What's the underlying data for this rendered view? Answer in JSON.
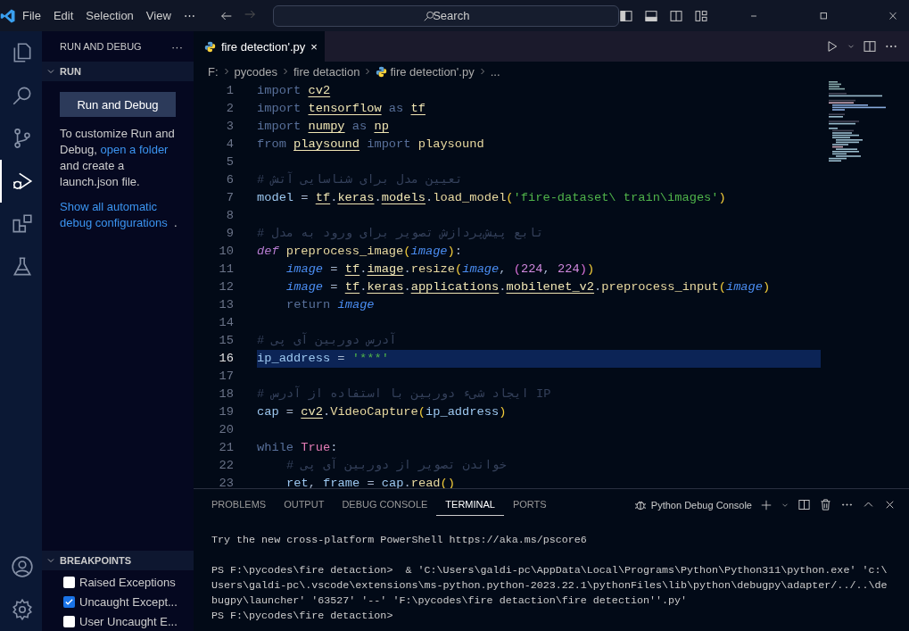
{
  "menu": [
    "File",
    "Edit",
    "Selection",
    "View",
    "⋯"
  ],
  "search": {
    "placeholder": "Search"
  },
  "activity_bar": [
    {
      "kind": "explorer",
      "selected": false
    },
    {
      "kind": "search",
      "selected": false
    },
    {
      "kind": "source-control",
      "selected": false
    },
    {
      "kind": "run-debug",
      "selected": true
    },
    {
      "kind": "extensions",
      "selected": false
    },
    {
      "kind": "testing",
      "selected": false
    }
  ],
  "sidebar": {
    "title": "RUN AND DEBUG",
    "more": "···",
    "run_section": {
      "title": "RUN",
      "expanded": true,
      "button": "Run and Debug",
      "text_before_link": "To customize Run and Debug, ",
      "link": "open a folder",
      "text_after_link": " and create a launch.json file.",
      "link2": "Show all automatic debug configurations",
      "after_link2": "."
    },
    "breakpoints": {
      "title": "BREAKPOINTS",
      "expanded": true,
      "items": [
        {
          "label": "Raised Exceptions",
          "checked": false
        },
        {
          "label": "Uncaught Except...",
          "checked": true
        },
        {
          "label": "User Uncaught E...",
          "checked": false
        }
      ]
    }
  },
  "tabs": [
    {
      "label": "fire detection'.py",
      "selected": true,
      "close": "×"
    }
  ],
  "breadcrumb": [
    "F:",
    "pycodes",
    "fire detaction",
    "fire detection'.py",
    "..."
  ],
  "code": [
    {
      "number": "1",
      "tokens": [
        {
          "kind": "keyword",
          "text": "import "
        },
        {
          "kind": "module",
          "text": "cv2"
        }
      ]
    },
    {
      "number": "2",
      "tokens": [
        {
          "kind": "keyword",
          "text": "import "
        },
        {
          "kind": "module",
          "text": "tensorflow"
        },
        {
          "kind": "keyword",
          "text": " as "
        },
        {
          "kind": "module",
          "text": "tf"
        }
      ]
    },
    {
      "number": "3",
      "tokens": [
        {
          "kind": "keyword",
          "text": "import "
        },
        {
          "kind": "module",
          "text": "numpy"
        },
        {
          "kind": "keyword",
          "text": " as "
        },
        {
          "kind": "module",
          "text": "np"
        }
      ]
    },
    {
      "number": "4",
      "tokens": [
        {
          "kind": "keyword",
          "text": "from "
        },
        {
          "kind": "module",
          "text": "playsound"
        },
        {
          "kind": "keyword",
          "text": " import "
        },
        {
          "kind": "function",
          "text": "playsound"
        }
      ]
    },
    {
      "number": "5"
    },
    {
      "number": "6",
      "tokens": [
        {
          "kind": "comment",
          "text": "# تعیین مدل برای شناسایی آتش"
        }
      ]
    },
    {
      "number": "7",
      "tokens": [
        {
          "kind": "variable",
          "text": "model"
        },
        {
          "kind": "plain",
          "text": " = "
        },
        {
          "kind": "module",
          "text": "tf"
        },
        {
          "kind": "plain",
          "text": "."
        },
        {
          "kind": "module",
          "text": "keras"
        },
        {
          "kind": "plain",
          "text": "."
        },
        {
          "kind": "module",
          "text": "models"
        },
        {
          "kind": "plain",
          "text": "."
        },
        {
          "kind": "function",
          "text": "load_model"
        },
        {
          "kind": "bracket",
          "text": "("
        },
        {
          "kind": "string",
          "text": "'fire-dataset\\ train\\images'"
        },
        {
          "kind": "bracket",
          "text": ")"
        }
      ]
    },
    {
      "number": "8"
    },
    {
      "number": "9",
      "tokens": [
        {
          "kind": "comment",
          "text": "# تابع پیش‌پردازش تصویر برای ورود به مدل"
        }
      ]
    },
    {
      "number": "10",
      "tokens": [
        {
          "kind": "def",
          "text": "def "
        },
        {
          "kind": "function",
          "text": "preprocess_image"
        },
        {
          "kind": "bracket",
          "text": "("
        },
        {
          "kind": "parameter",
          "text": "image"
        },
        {
          "kind": "bracket",
          "text": ")"
        },
        {
          "kind": "plain",
          "text": ":"
        }
      ]
    },
    {
      "number": "11",
      "indented": true,
      "tokens": [
        {
          "kind": "parameter",
          "text": "image"
        },
        {
          "kind": "plain",
          "text": " = "
        },
        {
          "kind": "module",
          "text": "tf"
        },
        {
          "kind": "plain",
          "text": "."
        },
        {
          "kind": "module",
          "text": "image"
        },
        {
          "kind": "plain",
          "text": "."
        },
        {
          "kind": "function",
          "text": "resize"
        },
        {
          "kind": "bracket",
          "text": "("
        },
        {
          "kind": "parameter",
          "text": "image"
        },
        {
          "kind": "plain",
          "text": ", "
        },
        {
          "kind": "bracket2",
          "text": "("
        },
        {
          "kind": "number",
          "text": "224"
        },
        {
          "kind": "plain",
          "text": ", "
        },
        {
          "kind": "number",
          "text": "224"
        },
        {
          "kind": "bracket2",
          "text": ")"
        },
        {
          "kind": "bracket",
          "text": ")"
        }
      ]
    },
    {
      "number": "12",
      "indented": true,
      "tokens": [
        {
          "kind": "parameter",
          "text": "image"
        },
        {
          "kind": "plain",
          "text": " = "
        },
        {
          "kind": "module",
          "text": "tf"
        },
        {
          "kind": "plain",
          "text": "."
        },
        {
          "kind": "module",
          "text": "keras"
        },
        {
          "kind": "plain",
          "text": "."
        },
        {
          "kind": "module",
          "text": "applications"
        },
        {
          "kind": "plain",
          "text": "."
        },
        {
          "kind": "module",
          "text": "mobilenet_v2"
        },
        {
          "kind": "plain",
          "text": "."
        },
        {
          "kind": "function",
          "text": "preprocess_input"
        },
        {
          "kind": "bracket",
          "text": "("
        },
        {
          "kind": "parameter",
          "text": "image"
        },
        {
          "kind": "bracket",
          "text": ")"
        }
      ]
    },
    {
      "number": "13",
      "indented": true,
      "tokens": [
        {
          "kind": "keyword",
          "text": "return "
        },
        {
          "kind": "parameter",
          "text": "image"
        }
      ]
    },
    {
      "number": "14"
    },
    {
      "number": "15",
      "tokens": [
        {
          "kind": "comment",
          "text": "# آدرس دوربین آی پی"
        }
      ]
    },
    {
      "number": "16",
      "current": true,
      "tokens": [
        {
          "kind": "variable",
          "text": "ip_address"
        },
        {
          "kind": "plain",
          "text": " = "
        },
        {
          "kind": "string",
          "text": "'***'"
        }
      ]
    },
    {
      "number": "17"
    },
    {
      "number": "18",
      "tokens": [
        {
          "kind": "comment",
          "text": "# ایجاد شیء دوربین با استفاده از آدرس IP"
        }
      ]
    },
    {
      "number": "19",
      "tokens": [
        {
          "kind": "variable",
          "text": "cap"
        },
        {
          "kind": "plain",
          "text": " = "
        },
        {
          "kind": "module",
          "text": "cv2"
        },
        {
          "kind": "plain",
          "text": "."
        },
        {
          "kind": "function",
          "text": "VideoCapture"
        },
        {
          "kind": "bracket",
          "text": "("
        },
        {
          "kind": "variable",
          "text": "ip_address"
        },
        {
          "kind": "bracket",
          "text": ")"
        }
      ]
    },
    {
      "number": "20"
    },
    {
      "number": "21",
      "tokens": [
        {
          "kind": "keyword",
          "text": "while "
        },
        {
          "kind": "constant",
          "text": "True"
        },
        {
          "kind": "plain",
          "text": ":"
        }
      ]
    },
    {
      "number": "22",
      "indented": true,
      "tokens": [
        {
          "kind": "comment",
          "text": "# خواندن تصویر از دوربین آی پی"
        }
      ]
    },
    {
      "number": "23",
      "indented": true,
      "tokens": [
        {
          "kind": "variable",
          "text": "ret"
        },
        {
          "kind": "plain",
          "text": ", "
        },
        {
          "kind": "variable",
          "text": "frame"
        },
        {
          "kind": "plain",
          "text": " = "
        },
        {
          "kind": "variable",
          "text": "cap"
        },
        {
          "kind": "plain",
          "text": "."
        },
        {
          "kind": "function",
          "text": "read"
        },
        {
          "kind": "bracket",
          "text": "()"
        }
      ]
    }
  ],
  "panel": {
    "tabs": [
      {
        "label": "PROBLEMS",
        "selected": false
      },
      {
        "label": "OUTPUT",
        "selected": false
      },
      {
        "label": "DEBUG CONSOLE",
        "selected": false
      },
      {
        "label": "TERMINAL",
        "selected": true
      },
      {
        "label": "PORTS",
        "selected": false
      }
    ],
    "terminal_name": "Python Debug Console",
    "terminal": [
      [
        "Try the new cross-platform PowerShell https://aka.ms/pscore6"
      ],
      [
        "PS F:\\pycodes\\fire detaction>  & 'C:\\Users\\galdi-pc\\AppData\\Local\\Programs\\Python\\Python311\\python.exe' 'c:\\",
        "Users\\galdi-pc\\.vscode\\extensions\\ms-python.python-2023.22.1\\pythonFiles\\lib\\python\\debugpy\\adapter/../..\\de",
        "bugpy\\launcher' '63527' '--' 'F:\\pycodes\\fire detaction\\fire detection''.py'",
        "PS F:\\pycodes\\fire detaction>"
      ]
    ]
  }
}
